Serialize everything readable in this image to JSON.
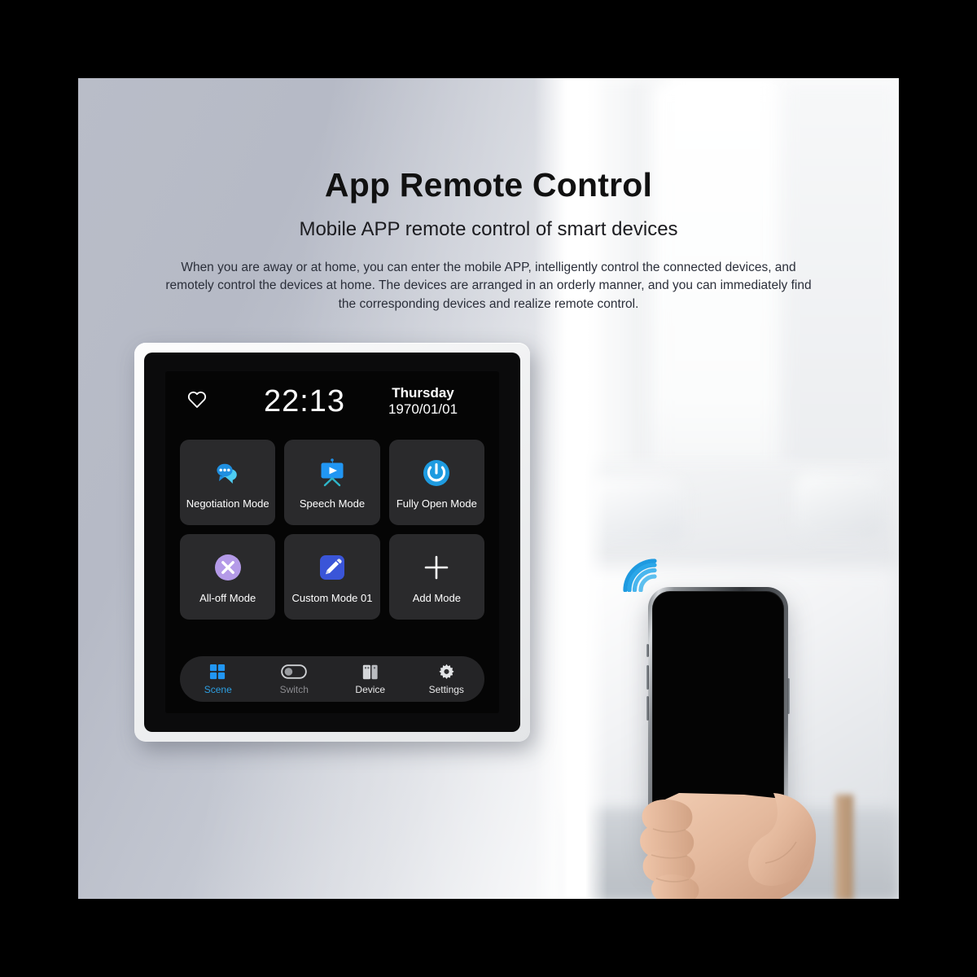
{
  "header": {
    "title": "App Remote Control",
    "subtitle": "Mobile APP remote control of smart devices",
    "description": "When you are away or at home, you can enter the mobile APP, intelligently control the connected devices, and remotely control the devices at home. The devices are arranged in an orderly manner, and you can immediately find the corresponding devices and realize remote control."
  },
  "panel": {
    "status": {
      "favorite_icon": "heart-icon",
      "time": "22:13",
      "weekday": "Thursday",
      "date": "1970/01/01"
    },
    "modes": [
      {
        "label": "Negotiation Mode",
        "icon": "chat-bubbles-icon",
        "color": "#1f8fe0"
      },
      {
        "label": "Speech Mode",
        "icon": "projector-screen-icon",
        "color": "#2196f3"
      },
      {
        "label": "Fully Open Mode",
        "icon": "power-icon",
        "color": "#1e9be0"
      },
      {
        "label": "All-off Mode",
        "icon": "close-circle-icon",
        "color": "#b49ae8"
      },
      {
        "label": "Custom Mode 01",
        "icon": "pencil-icon",
        "color": "#3a55d8"
      },
      {
        "label": "Add Mode",
        "icon": "plus-icon",
        "color": "#ffffff"
      }
    ],
    "nav": [
      {
        "label": "Scene",
        "icon": "grid-squares-icon",
        "state": "active"
      },
      {
        "label": "Switch",
        "icon": "toggle-off-icon",
        "state": "dim"
      },
      {
        "label": "Device",
        "icon": "wall-switch-icon",
        "state": "normal"
      },
      {
        "label": "Settings",
        "icon": "gear-icon",
        "state": "normal"
      }
    ]
  },
  "phone": {
    "signal_icon": "wifi-waves-icon",
    "screen_state": "off"
  },
  "colors": {
    "accent_blue": "#2d9ee0",
    "scene_blue": "#2196f3",
    "purple": "#b49ae8",
    "tile_bg": "#2a2a2c",
    "screen_bg": "#050505"
  }
}
